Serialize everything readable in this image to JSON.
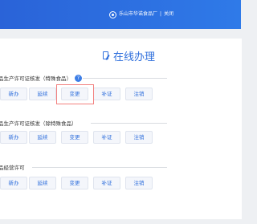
{
  "header": {
    "user": "乐山市华诺食品厂",
    "logout": "关闭"
  },
  "main": {
    "title": "在线办理",
    "sections": [
      {
        "heading": "品生产许可证核发（特殊食品）",
        "has_help": true,
        "help_icon": "?",
        "buttons": [
          "新办",
          "延续",
          "变更",
          "补证",
          "注销"
        ]
      },
      {
        "heading": "品生产许可证核发（除特殊食品）",
        "has_help": false,
        "buttons": [
          "新办",
          "延续",
          "变更",
          "补证",
          "注销"
        ]
      },
      {
        "heading": "品经营许可",
        "has_help": false,
        "buttons": [
          "新办",
          "延续",
          "变更",
          "补证",
          "注销"
        ]
      }
    ]
  },
  "colors": {
    "header_bg": "#2f6fe0",
    "accent": "#2f6fdc",
    "highlight_border": "#f2807f"
  },
  "highlighted_button": "变更"
}
